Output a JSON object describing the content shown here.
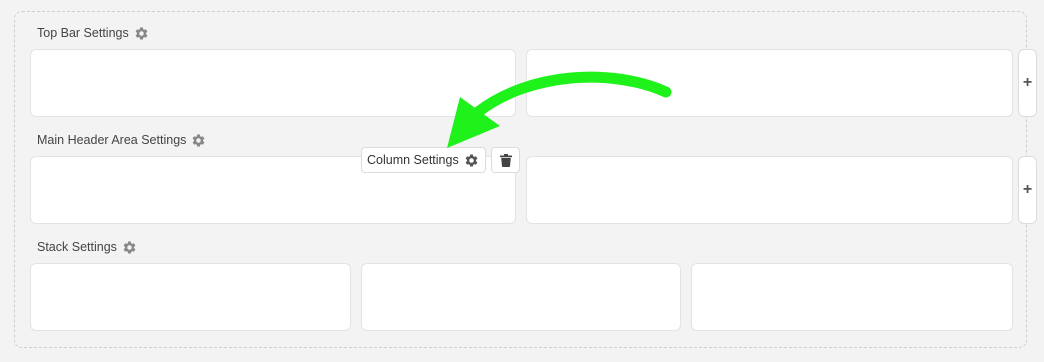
{
  "sections": [
    {
      "title": "Top Bar Settings"
    },
    {
      "title": "Main Header Area Settings"
    },
    {
      "title": "Stack Settings"
    }
  ],
  "column_toolbar": {
    "settings_label": "Column Settings"
  },
  "add_button": {
    "label": "+"
  },
  "icons": {
    "settings": "gear-icon",
    "delete": "trash-icon",
    "add": "plus-icon",
    "annotation": "curved-arrow"
  },
  "colors": {
    "annotation_arrow": "#1ff21a",
    "panel_background": "#f3f3f3",
    "column_background": "#ffffff",
    "icon_gray": "#888888"
  }
}
